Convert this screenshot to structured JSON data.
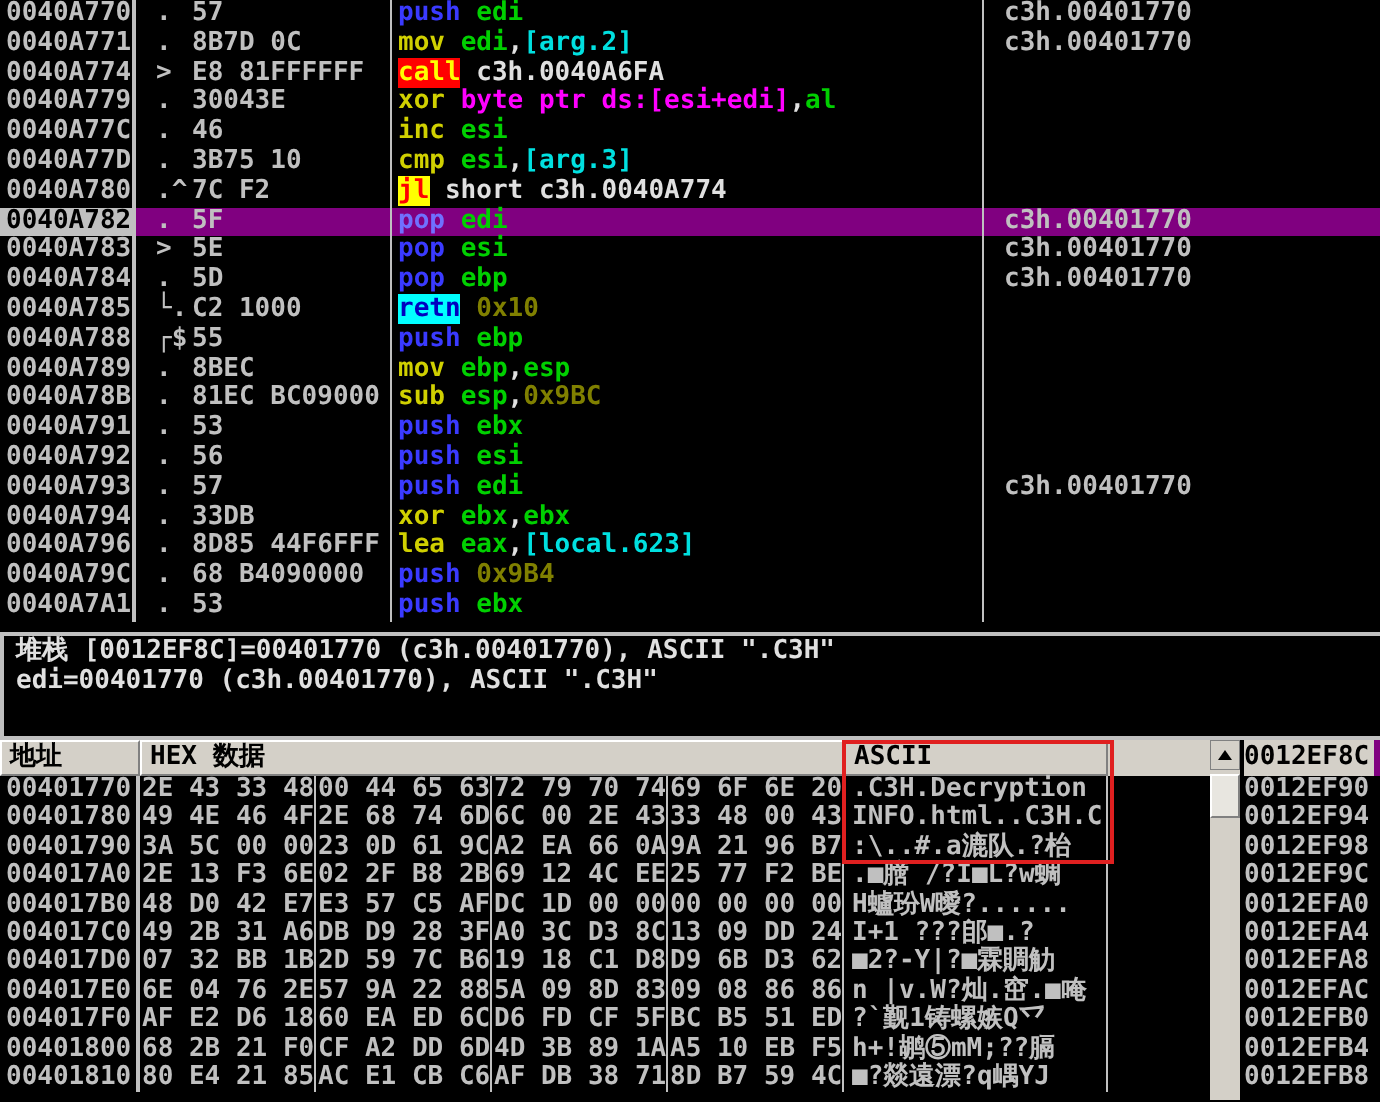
{
  "disassembly": {
    "rows": [
      {
        "address": "0040A770",
        "mark": ".",
        "hex": "57",
        "mnemonic": "push",
        "kind": "stack",
        "operands": [
          {
            "text": "edi",
            "kind": "reg"
          }
        ],
        "comment": "c3h.00401770",
        "selected": false
      },
      {
        "address": "0040A771",
        "mark": ".",
        "hex": "8B7D 0C",
        "mnemonic": "mov",
        "kind": "plain",
        "operands": [
          {
            "text": "edi",
            "kind": "reg"
          },
          {
            "text": ",",
            "kind": "sep"
          },
          {
            "text": "[arg.2]",
            "kind": "mem"
          }
        ],
        "comment": "c3h.00401770",
        "selected": false
      },
      {
        "address": "0040A774",
        "mark": ">",
        "hex": "E8 81FFFFFF",
        "mnemonic": "call",
        "kind": "call",
        "operands": [
          {
            "text": "c3h.0040A6FA",
            "kind": "label"
          }
        ],
        "selected": false
      },
      {
        "address": "0040A779",
        "mark": ".",
        "hex": "30043E",
        "mnemonic": "xor",
        "kind": "plain",
        "operands": [
          {
            "text": "byte ptr ds:[esi+edi]",
            "kind": "ptr"
          },
          {
            "text": ",",
            "kind": "sep"
          },
          {
            "text": "al",
            "kind": "reg"
          }
        ],
        "selected": false
      },
      {
        "address": "0040A77C",
        "mark": ".",
        "hex": "46",
        "mnemonic": "inc",
        "kind": "plain",
        "operands": [
          {
            "text": "esi",
            "kind": "reg"
          }
        ],
        "selected": false
      },
      {
        "address": "0040A77D",
        "mark": ".",
        "hex": "3B75 10",
        "mnemonic": "cmp",
        "kind": "plain",
        "operands": [
          {
            "text": "esi",
            "kind": "reg"
          },
          {
            "text": ",",
            "kind": "sep"
          },
          {
            "text": "[arg.3]",
            "kind": "mem"
          }
        ],
        "selected": false
      },
      {
        "address": "0040A780",
        "mark": ".^",
        "hex": "7C F2",
        "mnemonic": "jl",
        "kind": "jump",
        "operands": [
          {
            "text": "short c3h.0040A774",
            "kind": "label"
          }
        ],
        "selected": false
      },
      {
        "address": "0040A782",
        "mark": ".",
        "hex": "5F",
        "mnemonic": "pop",
        "kind": "stack",
        "operands": [
          {
            "text": "edi",
            "kind": "reg"
          }
        ],
        "comment": "c3h.00401770",
        "selected": true
      },
      {
        "address": "0040A783",
        "mark": ">",
        "hex": "5E",
        "mnemonic": "pop",
        "kind": "stack",
        "operands": [
          {
            "text": "esi",
            "kind": "reg"
          }
        ],
        "comment": "c3h.00401770",
        "selected": false
      },
      {
        "address": "0040A784",
        "mark": ".",
        "hex": "5D",
        "mnemonic": "pop",
        "kind": "stack",
        "operands": [
          {
            "text": "ebp",
            "kind": "reg"
          }
        ],
        "comment": "c3h.00401770",
        "selected": false
      },
      {
        "address": "0040A785",
        "mark": "└.",
        "hex": "C2 1000",
        "mnemonic": "retn",
        "kind": "ret",
        "operands": [
          {
            "text": "0x10",
            "kind": "imm"
          }
        ],
        "selected": false
      },
      {
        "address": "0040A788",
        "mark": "┌$",
        "hex": "55",
        "mnemonic": "push",
        "kind": "stack",
        "operands": [
          {
            "text": "ebp",
            "kind": "reg"
          }
        ],
        "selected": false
      },
      {
        "address": "0040A789",
        "mark": ".",
        "hex": "8BEC",
        "mnemonic": "mov",
        "kind": "plain",
        "operands": [
          {
            "text": "ebp",
            "kind": "reg"
          },
          {
            "text": ",",
            "kind": "sep"
          },
          {
            "text": "esp",
            "kind": "reg"
          }
        ],
        "selected": false
      },
      {
        "address": "0040A78B",
        "mark": ".",
        "hex": "81EC BC09000",
        "mnemonic": "sub",
        "kind": "plain",
        "operands": [
          {
            "text": "esp",
            "kind": "reg"
          },
          {
            "text": ",",
            "kind": "sep"
          },
          {
            "text": "0x9BC",
            "kind": "imm"
          }
        ],
        "selected": false
      },
      {
        "address": "0040A791",
        "mark": ".",
        "hex": "53",
        "mnemonic": "push",
        "kind": "stack",
        "operands": [
          {
            "text": "ebx",
            "kind": "reg"
          }
        ],
        "selected": false
      },
      {
        "address": "0040A792",
        "mark": ".",
        "hex": "56",
        "mnemonic": "push",
        "kind": "stack",
        "operands": [
          {
            "text": "esi",
            "kind": "reg"
          }
        ],
        "selected": false
      },
      {
        "address": "0040A793",
        "mark": ".",
        "hex": "57",
        "mnemonic": "push",
        "kind": "stack",
        "operands": [
          {
            "text": "edi",
            "kind": "reg"
          }
        ],
        "comment": "c3h.00401770",
        "selected": false
      },
      {
        "address": "0040A794",
        "mark": ".",
        "hex": "33DB",
        "mnemonic": "xor",
        "kind": "plain",
        "operands": [
          {
            "text": "ebx",
            "kind": "reg"
          },
          {
            "text": ",",
            "kind": "sep"
          },
          {
            "text": "ebx",
            "kind": "reg"
          }
        ],
        "selected": false
      },
      {
        "address": "0040A796",
        "mark": ".",
        "hex": "8D85 44F6FFF",
        "mnemonic": "lea",
        "kind": "plain",
        "operands": [
          {
            "text": "eax",
            "kind": "reg"
          },
          {
            "text": ",",
            "kind": "sep"
          },
          {
            "text": "[local.623]",
            "kind": "mem"
          }
        ],
        "selected": false
      },
      {
        "address": "0040A79C",
        "mark": ".",
        "hex": "68 B4090000",
        "mnemonic": "push",
        "kind": "stack",
        "operands": [
          {
            "text": "0x9B4",
            "kind": "imm"
          }
        ],
        "selected": false
      },
      {
        "address": "0040A7A1",
        "mark": ".",
        "hex": "53",
        "mnemonic": "push",
        "kind": "stack",
        "operands": [
          {
            "text": "ebx",
            "kind": "reg"
          }
        ],
        "selected": false
      }
    ]
  },
  "info": {
    "lines": [
      "堆栈 [0012EF8C]=00401770 (c3h.00401770), ASCII \".C3H\"",
      "edi=00401770 (c3h.00401770), ASCII \".C3H\""
    ]
  },
  "dump": {
    "columns": [
      "地址",
      "HEX 数据",
      "ASCII"
    ],
    "rows": [
      {
        "address": "00401770",
        "hex": [
          "2E 43 33 48",
          "00 44 65 63",
          "72 79 70 74",
          "69 6F 6E 20"
        ],
        "ascii": ".C3H.Decryption"
      },
      {
        "address": "00401780",
        "hex": [
          "49 4E 46 4F",
          "2E 68 74 6D",
          "6C 00 2E 43",
          "33 48 00 43"
        ],
        "ascii": "INFO.html..C3H.C"
      },
      {
        "address": "00401790",
        "hex": [
          "3A 5C 00 00",
          "23 0D 61 9C",
          "A2 EA 66 0A",
          "9A 21 96 B7"
        ],
        "ascii": ":\\..#.a漉队.?枱"
      },
      {
        "address": "004017A0",
        "hex": [
          "2E 13 F3 6E",
          "02 2F B8 2B",
          "69 12 4C EE",
          "25 77 F2 BE"
        ],
        "ascii": ".■膪 /?I■L?w蜩"
      },
      {
        "address": "004017B0",
        "hex": [
          "48 D0 42 E7",
          "E3 57 C5 AF",
          "DC 1D 00 00",
          "00 00 00 00"
        ],
        "ascii": "H蠦玢W曖?......"
      },
      {
        "address": "004017C0",
        "hex": [
          "49 2B 31 A6",
          "DB D9 28 3F",
          "A0 3C D3 8C",
          "13 09 DD 24"
        ],
        "ascii": "I+1  ???郋■.?"
      },
      {
        "address": "004017D0",
        "hex": [
          "07 32 BB 1B",
          "2D 59 7C B6",
          "19 18 C1 D8",
          "D9 6B D3 62"
        ],
        "ascii": "■2?-Y|?■霖賙觔"
      },
      {
        "address": "004017E0",
        "hex": [
          "6E 04 76 2E",
          "57 9A 22 88",
          "5A 09 8D 83",
          "09 08 86 86"
        ],
        "ascii": "n |v.W?灿.窋.■唵"
      },
      {
        "address": "004017F0",
        "hex": [
          "AF E2 D6 18",
          "60 EA ED 6C",
          "D6 FD CF 5F",
          "BC B5 51 ED"
        ],
        "ascii": " ?`觐1铸螺嫉Q乊"
      },
      {
        "address": "00401800",
        "hex": [
          "68 2B 21 F0",
          "CF A2 DD 6D",
          "4D 3B 89 1A",
          "A5 10 EB F5"
        ],
        "ascii": "h+!鹕⑤mM;??膈"
      },
      {
        "address": "00401810",
        "hex": [
          "80 E4 21 85",
          "AC E1 CB C6",
          "AF DB 38 71",
          "8D B7 59 4C"
        ],
        "ascii": "■?燚遠漂?q嵎YJ"
      }
    ]
  },
  "stack": {
    "items": [
      {
        "address": "0012EF8C",
        "selected": true
      },
      {
        "address": "0012EF90",
        "selected": false
      },
      {
        "address": "0012EF94",
        "selected": false
      },
      {
        "address": "0012EF98",
        "selected": false
      },
      {
        "address": "0012EF9C",
        "selected": false
      },
      {
        "address": "0012EFA0",
        "selected": false
      },
      {
        "address": "0012EFA4",
        "selected": false
      },
      {
        "address": "0012EFA8",
        "selected": false
      },
      {
        "address": "0012EFAC",
        "selected": false
      },
      {
        "address": "0012EFB0",
        "selected": false
      },
      {
        "address": "0012EFB4",
        "selected": false
      },
      {
        "address": "0012EFB8",
        "selected": false
      }
    ]
  }
}
